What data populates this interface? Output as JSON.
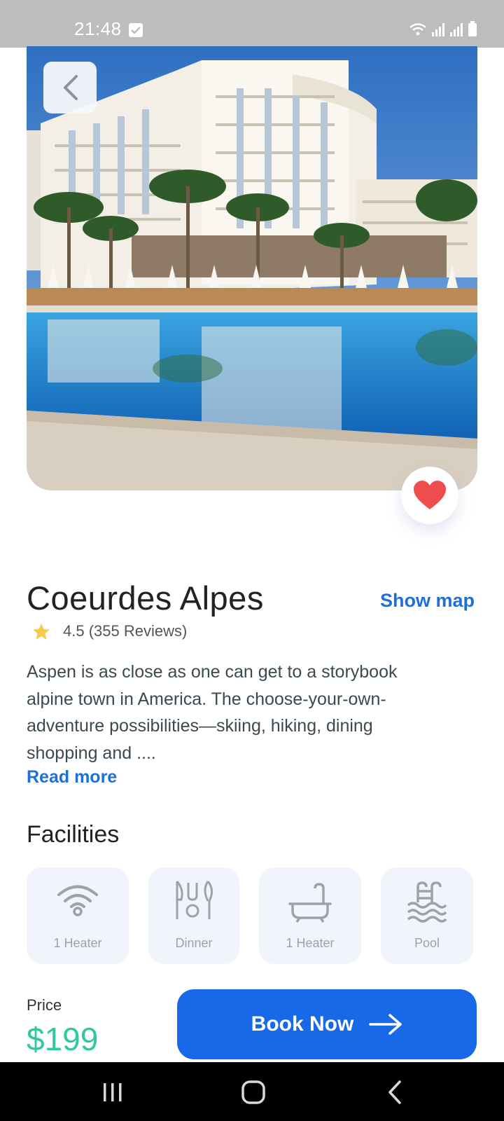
{
  "status_bar": {
    "time": "21:48"
  },
  "hotel": {
    "name": "Coeurdes Alpes",
    "show_map_label": "Show map",
    "rating_text": "4.5 (355 Reviews)",
    "description_lines": [
      "Aspen is as close as one can get to a storybook",
      "alpine town in America. The choose-your-own-",
      "adventure possibilities—skiing, hiking, dining",
      "shopping and ...."
    ],
    "read_more_label": "Read more"
  },
  "facilities": {
    "title": "Facilities",
    "items": [
      {
        "label": "1 Heater",
        "icon": "wifi-icon"
      },
      {
        "label": "Dinner",
        "icon": "dinner-icon"
      },
      {
        "label": "1 Heater",
        "icon": "bathtub-icon"
      },
      {
        "label": "Pool",
        "icon": "pool-icon"
      }
    ]
  },
  "booking": {
    "price_label": "Price",
    "price_value": "$199",
    "book_label": "Book Now"
  },
  "colors": {
    "accent": "#1769e8",
    "link": "#1f6fd8",
    "price": "#2fc9a0",
    "heart": "#ef4d4d",
    "star": "#f7c948"
  }
}
